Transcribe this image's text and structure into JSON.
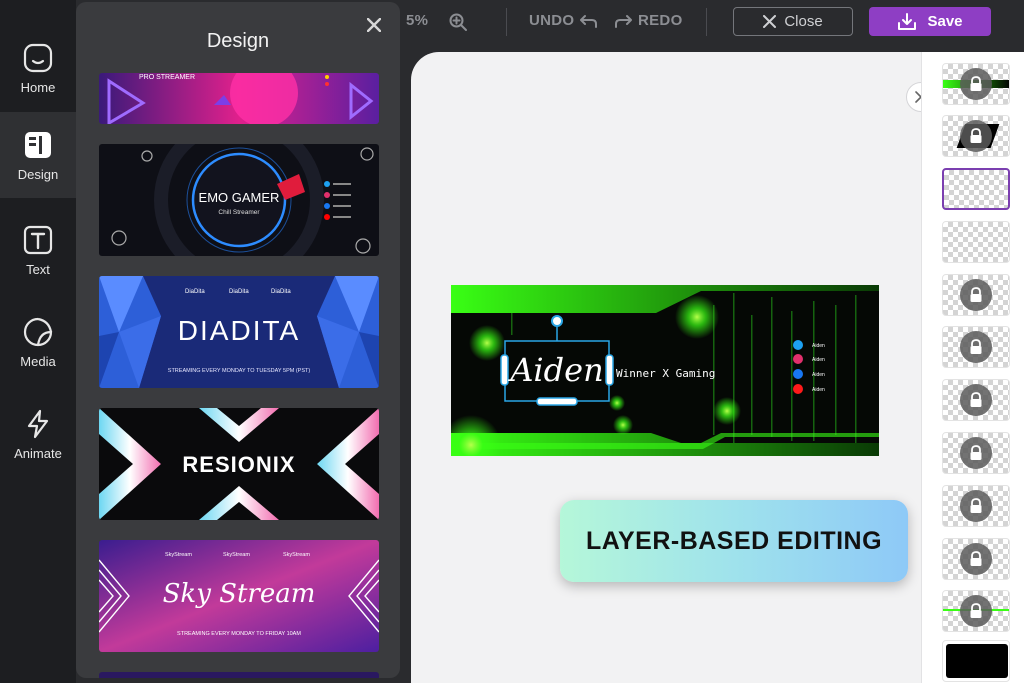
{
  "nav": {
    "items": [
      {
        "label": "Home",
        "icon": "home-icon"
      },
      {
        "label": "Design",
        "icon": "design-icon",
        "active": true
      },
      {
        "label": "Text",
        "icon": "text-icon"
      },
      {
        "label": "Media",
        "icon": "media-icon"
      },
      {
        "label": "Animate",
        "icon": "animate-icon"
      }
    ]
  },
  "panel": {
    "title": "Design",
    "templates": [
      {
        "name": "pro-streamer",
        "title": "PRO STREAMER"
      },
      {
        "name": "emo-gamer",
        "title": "EMO GAMER",
        "subtitle": "Chill Streamer"
      },
      {
        "name": "diadita",
        "title": "DIADITA",
        "handle": "DiaDita",
        "tagline": "STREAMING EVERY MONDAY TO TUESDAY 5PM (PST)"
      },
      {
        "name": "resionix",
        "title": "RESIONIX"
      },
      {
        "name": "sky-stream",
        "title": "Sky Stream",
        "handle": "SkyStream",
        "tagline": "STREAMING EVERY MONDAY TO FRIDAY 10AM"
      }
    ]
  },
  "toolbar": {
    "zoom": "5%",
    "undo_label": "UNDO",
    "redo_label": "REDO",
    "close_label": "Close",
    "save_label": "Save",
    "accent": "#8e3ec4"
  },
  "canvas": {
    "banner": {
      "name": "Aiden",
      "tagline": "Winner X Gaming",
      "social_handle": "Aiden",
      "accent": "#39ff14"
    },
    "caption": "LAYER-BASED EDITING"
  },
  "layers": {
    "count": 12,
    "selected_index": 2
  }
}
